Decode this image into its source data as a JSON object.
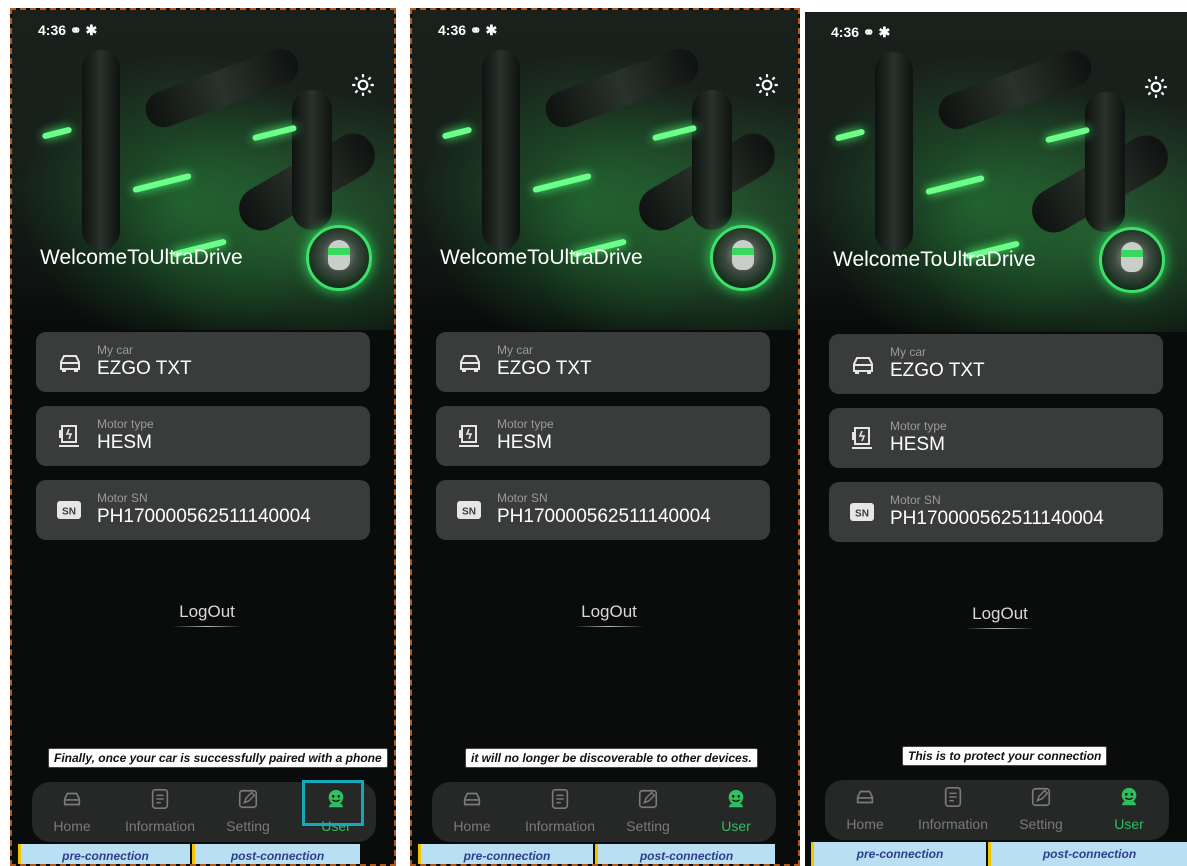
{
  "panels": [
    {
      "status_time": "4:36",
      "welcome": "WelcomeToUltraDrive",
      "cards": [
        {
          "label": "My car",
          "value": "EZGO TXT",
          "icon": "car-icon"
        },
        {
          "label": "Motor type",
          "value": "HESM",
          "icon": "motor-icon"
        },
        {
          "label": "Motor SN",
          "value": "PH170000562511140004",
          "icon": "sn-badge-icon"
        }
      ],
      "logout": "LogOut",
      "caption": "Finally, once your car is successfully paired with a phone",
      "nav": [
        "Home",
        "Information",
        "Setting",
        "User"
      ],
      "tags": [
        "pre-connection",
        "post-connection"
      ]
    },
    {
      "status_time": "4:36",
      "welcome": "WelcomeToUltraDrive",
      "cards": [
        {
          "label": "My car",
          "value": "EZGO TXT",
          "icon": "car-icon"
        },
        {
          "label": "Motor type",
          "value": "HESM",
          "icon": "motor-icon"
        },
        {
          "label": "Motor SN",
          "value": "PH170000562511140004",
          "icon": "sn-badge-icon"
        }
      ],
      "logout": "LogOut",
      "caption": "it will no longer be discoverable to other devices.",
      "nav": [
        "Home",
        "Information",
        "Setting",
        "User"
      ],
      "tags": [
        "pre-connection",
        "post-connection"
      ]
    },
    {
      "status_time": "4:36",
      "welcome": "WelcomeToUltraDrive",
      "cards": [
        {
          "label": "My car",
          "value": "EZGO TXT",
          "icon": "car-icon"
        },
        {
          "label": "Motor type",
          "value": "HESM",
          "icon": "motor-icon"
        },
        {
          "label": "Motor SN",
          "value": "PH170000562511140004",
          "icon": "sn-badge-icon"
        }
      ],
      "logout": "LogOut",
      "caption": "This is to protect your connection",
      "nav": [
        "Home",
        "Information",
        "Setting",
        "User"
      ],
      "tags": [
        "pre-connection",
        "post-connection"
      ]
    }
  ],
  "sn_badge_text": "SN",
  "colors": {
    "accent": "#2fbf5f",
    "highlight": "#14a8b8",
    "card": "#3a3b3b",
    "tag": "#b9dff2"
  }
}
